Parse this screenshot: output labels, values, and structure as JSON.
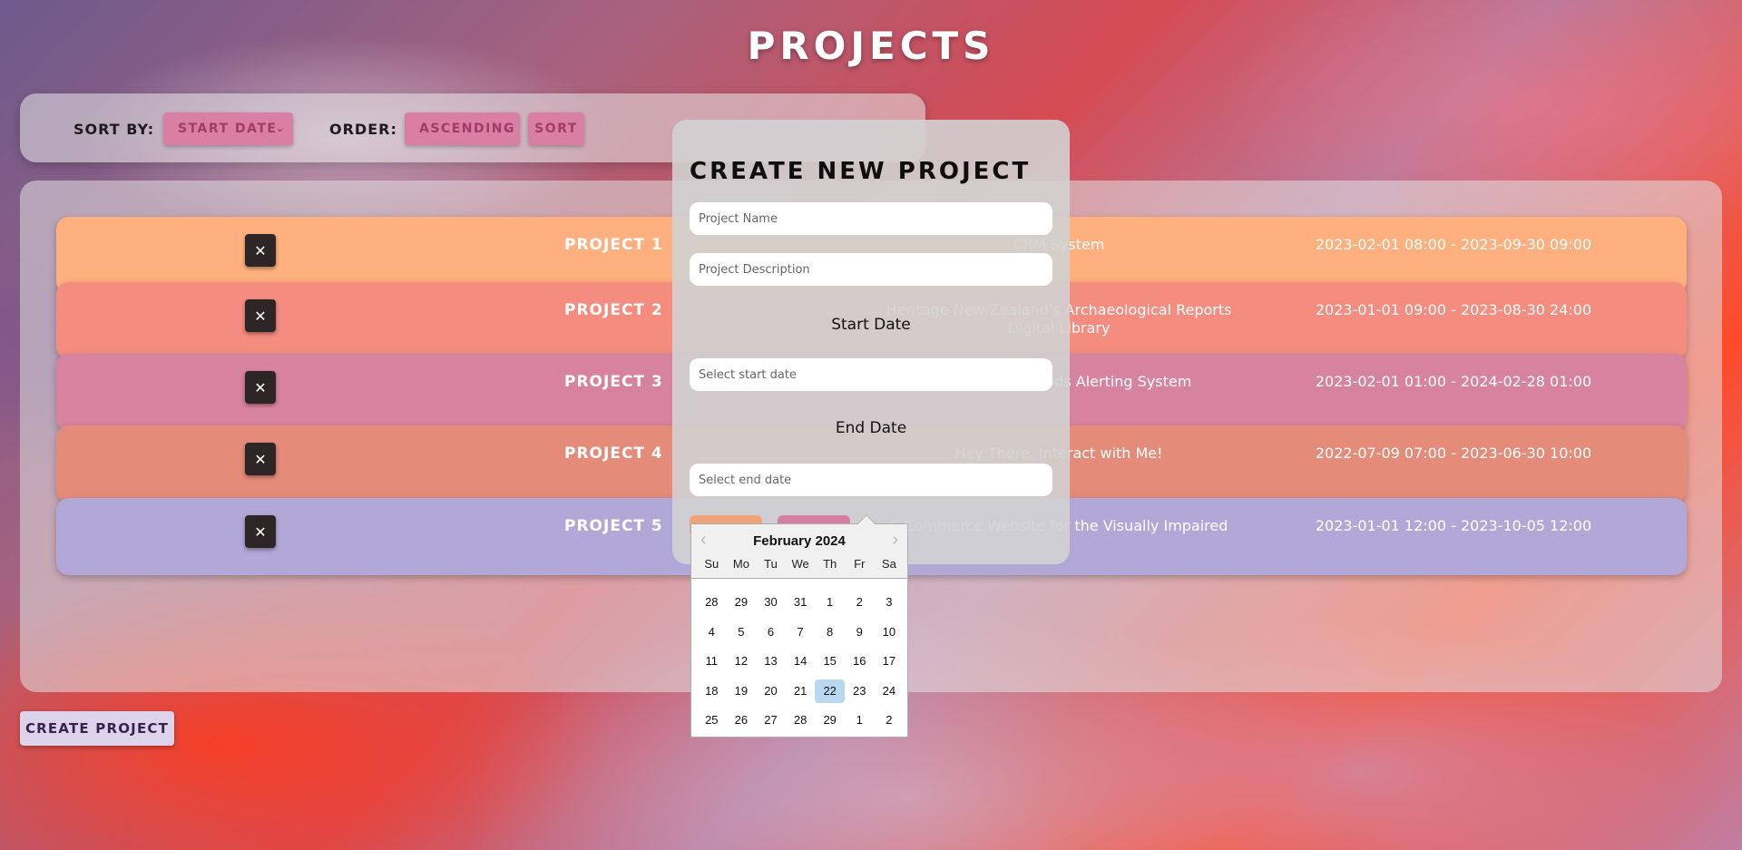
{
  "page": {
    "title": "PROJECTS"
  },
  "sort_bar": {
    "sort_by_label": "SORT BY:",
    "sort_by_value": "START DATE",
    "order_label": "ORDER:",
    "order_value": "ASCENDING",
    "sort_button": "SORT"
  },
  "projects": [
    {
      "name": "PROJECT 1",
      "description": "CRM System",
      "dates": "2023-02-01 08:00 - 2023-09-30 09:00",
      "color": "#ffb07e"
    },
    {
      "name": "PROJECT 2",
      "description": "Heritage New Zealand's Archaeological Reports Digital Library",
      "dates": "2023-01-01 09:00 - 2023-08-30 24:00",
      "color": "#f48c80"
    },
    {
      "name": "PROJECT 3",
      "description": "Local Charity Goods Alerting System",
      "dates": "2023-02-01 01:00 - 2024-02-28 01:00",
      "color": "#d783a0"
    },
    {
      "name": "PROJECT 4",
      "description": "Hey There, Interact with Me!",
      "dates": "2022-07-09 07:00 - 2023-06-30 10:00",
      "color": "#e58b7a"
    },
    {
      "name": "PROJECT 5",
      "description": "E-Commerce Website for the Visually Impaired",
      "dates": "2023-01-01 12:00 - 2023-10-05 12:00",
      "color": "#b2a8d8"
    }
  ],
  "delete_glyph": "✕",
  "create_button": "CREATE PROJECT",
  "modal": {
    "title": "CREATE NEW PROJECT",
    "name_placeholder": "Project Name",
    "description_placeholder": "Project Description",
    "start_label": "Start Date",
    "start_placeholder": "Select start date",
    "end_label": "End Date",
    "end_placeholder": "Select end date"
  },
  "datepicker": {
    "month": "February 2024",
    "weekdays": [
      "Su",
      "Mo",
      "Tu",
      "We",
      "Th",
      "Fr",
      "Sa"
    ],
    "weeks": [
      [
        "28",
        "29",
        "30",
        "31",
        "1",
        "2",
        "3"
      ],
      [
        "4",
        "5",
        "6",
        "7",
        "8",
        "9",
        "10"
      ],
      [
        "11",
        "12",
        "13",
        "14",
        "15",
        "16",
        "17"
      ],
      [
        "18",
        "19",
        "20",
        "21",
        "22",
        "23",
        "24"
      ],
      [
        "25",
        "26",
        "27",
        "28",
        "29",
        "1",
        "2"
      ]
    ],
    "selected_day": "22"
  }
}
